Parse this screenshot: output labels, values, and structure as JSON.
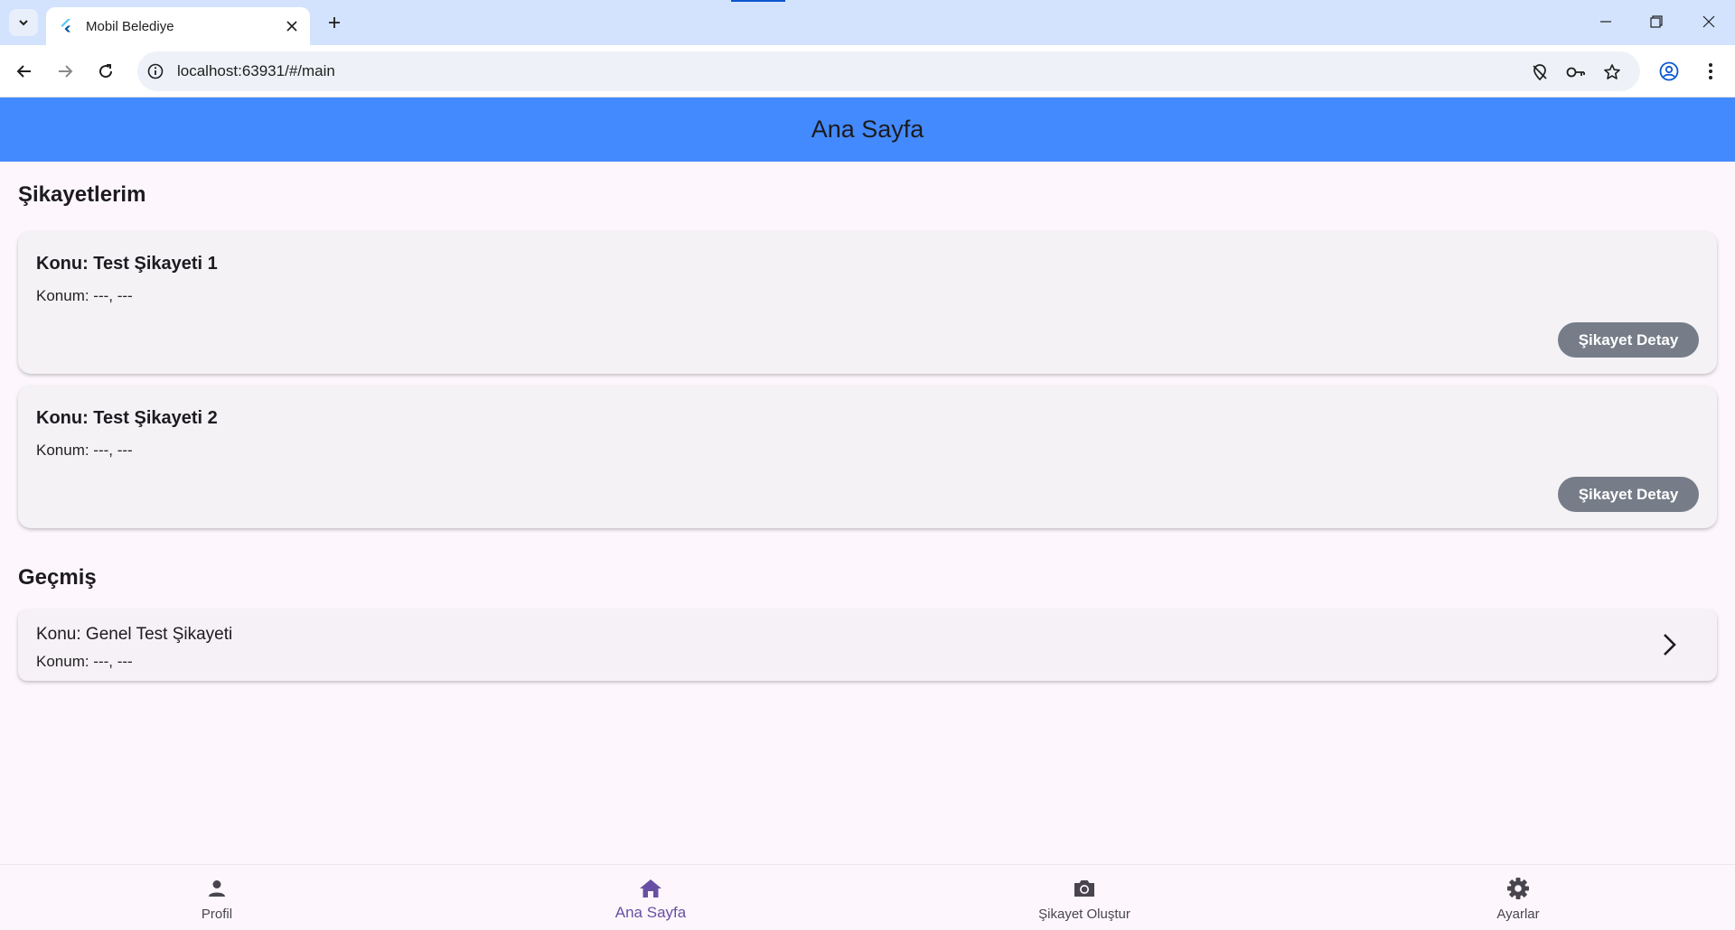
{
  "browser": {
    "tab_title": "Mobil Belediye",
    "url": "localhost:63931/#/main"
  },
  "appbar": {
    "title": "Ana Sayfa",
    "color": "#448aff"
  },
  "complaints": {
    "section_title": "Şikayetlerim",
    "items": [
      {
        "subject": "Konu: Test Şikayeti 1",
        "location": "Konum: ---, ---",
        "button_label": "Şikayet Detay"
      },
      {
        "subject": "Konu: Test Şikayeti 2",
        "location": "Konum: ---, ---",
        "button_label": "Şikayet Detay"
      }
    ]
  },
  "history": {
    "section_title": "Geçmiş",
    "items": [
      {
        "subject": "Konu: Genel Test Şikayeti",
        "location": "Konum: ---, ---",
        "icon": "chevron-right-icon"
      }
    ]
  },
  "bottom_nav": {
    "active_color": "#6750a4",
    "items": [
      {
        "label": "Profil",
        "icon": "person-icon",
        "active": false
      },
      {
        "label": "Ana Sayfa",
        "icon": "home-icon",
        "active": true
      },
      {
        "label": "Şikayet Oluştur",
        "icon": "camera-icon",
        "active": false
      },
      {
        "label": "Ayarlar",
        "icon": "gear-icon",
        "active": false
      }
    ]
  }
}
